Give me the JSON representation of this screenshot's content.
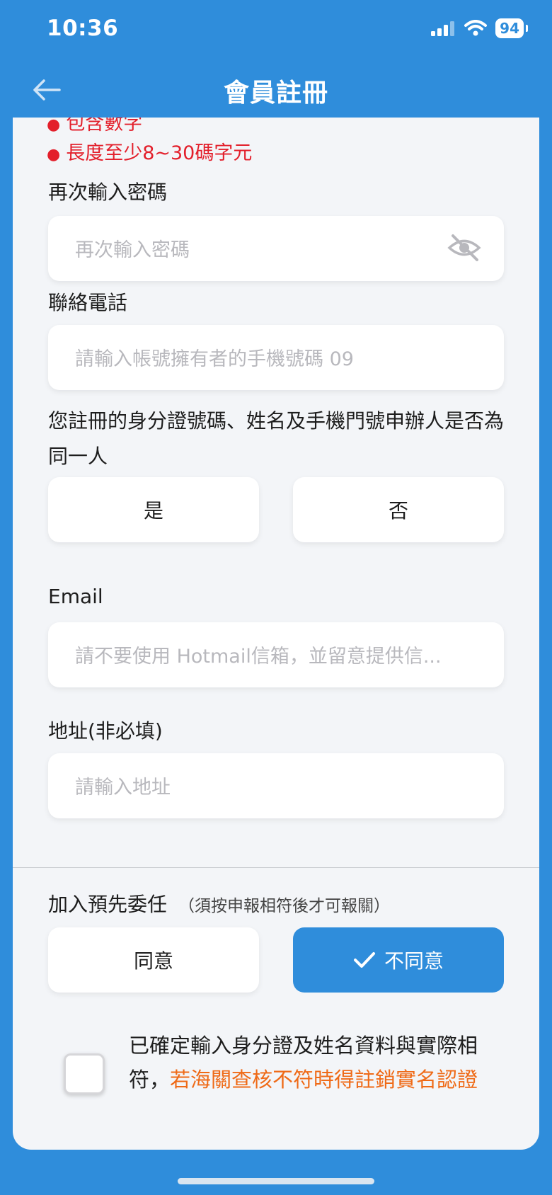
{
  "status_bar": {
    "time": "10:36",
    "battery": "94"
  },
  "header": {
    "title": "會員註冊"
  },
  "password_rules": [
    "包含數字",
    "長度至少8~30碼字元"
  ],
  "confirm_password": {
    "label": "再次輸入密碼",
    "placeholder": "再次輸入密碼"
  },
  "phone": {
    "label": "聯絡電話",
    "placeholder": "請輸入帳號擁有者的手機號碼 09"
  },
  "same_person": {
    "question": "您註冊的身分證號碼、姓名及手機門號申辦人是否為同一人",
    "yes_label": "是",
    "no_label": "否"
  },
  "email": {
    "label": "Email",
    "placeholder": "請不要使用 Hotmail信箱，並留意提供信..."
  },
  "address": {
    "label": "地址(非必填)",
    "placeholder": "請輸入地址"
  },
  "entrust": {
    "label": "加入預先委任",
    "note": "（須按申報相符後才可報關）",
    "agree_label": "同意",
    "disagree_label": "不同意",
    "selected": "disagree"
  },
  "consent": {
    "text": "已確定輸入身分證及姓名資料與實際相符，",
    "warning": "若海關查核不符時得註銷實名認證",
    "checked": false
  },
  "colors": {
    "primary": "#2f8ddb",
    "error": "#e31f2b",
    "warning": "#ef6a17"
  }
}
